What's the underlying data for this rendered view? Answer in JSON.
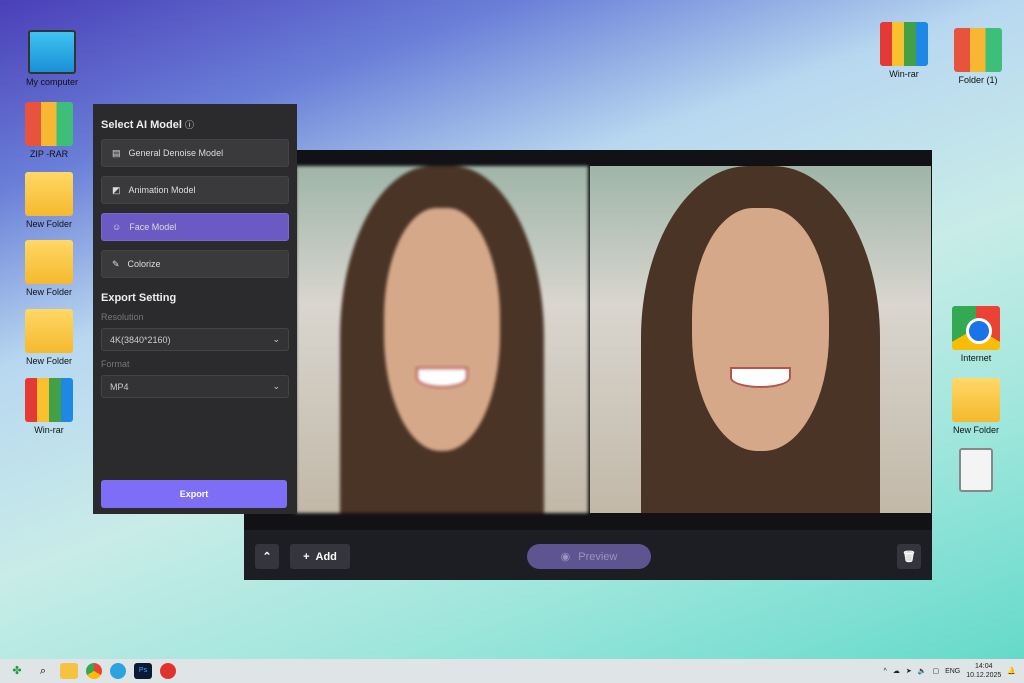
{
  "desktop_left": [
    {
      "label": "My computer",
      "type": "monitor"
    },
    {
      "label": "ZIP -RAR",
      "type": "binders"
    },
    {
      "label": "New Folder",
      "type": "folder"
    },
    {
      "label": "New Folder",
      "type": "folder"
    },
    {
      "label": "New Folder",
      "type": "folder"
    },
    {
      "label": "Win-rar",
      "type": "rar"
    }
  ],
  "desktop_right": [
    {
      "label": "Win-rar"
    },
    {
      "label": "Folder (1)"
    },
    {
      "label": "Internet"
    },
    {
      "label": "New Folder"
    },
    {
      "label": ""
    }
  ],
  "panel": {
    "title": "Select AI Model",
    "models": [
      {
        "label": "General Denoise Model",
        "icon": "film-icon"
      },
      {
        "label": "Animation Model",
        "icon": "shapes-icon"
      },
      {
        "label": "Face Model",
        "icon": "face-icon",
        "active": true
      },
      {
        "label": "Colorize",
        "icon": "brush-icon"
      }
    ],
    "export_title": "Export Setting",
    "resolution_label": "Resolution",
    "resolution_value": "4K(3840*2160)",
    "format_label": "Format",
    "format_value": "MP4",
    "export_button": "Export"
  },
  "viewer": {
    "add_label": "Add",
    "preview_label": "Preview"
  },
  "taskbar": {
    "lang": "ENG",
    "time": "14:04",
    "date": "10.12.2025"
  },
  "colors": {
    "accent": "#7d6ef5",
    "active": "#6b59c4"
  }
}
